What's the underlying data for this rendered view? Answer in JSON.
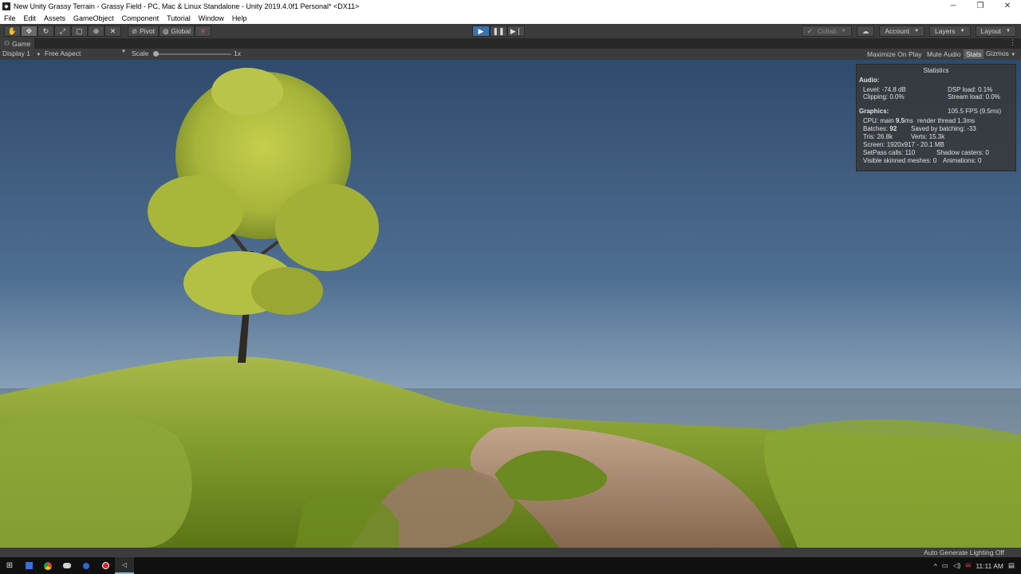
{
  "window": {
    "title": "New Unity Grassy Terrain - Grassy Field - PC, Mac & Linux Standalone - Unity 2019.4.0f1 Personal* <DX11>",
    "app_icon": "unity-icon",
    "controls": {
      "minimize": "─",
      "maximize": "❐",
      "close": "✕"
    }
  },
  "menu": [
    "File",
    "Edit",
    "Assets",
    "GameObject",
    "Component",
    "Tutorial",
    "Window",
    "Help"
  ],
  "toolbar": {
    "tools": [
      {
        "name": "hand-tool",
        "glyph": "✋"
      },
      {
        "name": "move-tool",
        "glyph": "✥"
      },
      {
        "name": "rotate-tool",
        "glyph": "↻"
      },
      {
        "name": "scale-tool",
        "glyph": "⤢"
      },
      {
        "name": "rect-tool",
        "glyph": "▢"
      },
      {
        "name": "transform-tool",
        "glyph": "⊕"
      },
      {
        "name": "custom-tool",
        "glyph": "✕"
      }
    ],
    "pivot_label": "Pivot",
    "global_label": "Global",
    "grid_icon": "#",
    "play_glyph": "▶",
    "pause_glyph": "❚❚",
    "step_glyph": "▶❘",
    "collab_label": "Collab",
    "account_label": "Account",
    "layers_label": "Layers",
    "layout_label": "Layout"
  },
  "game_tab": {
    "label": "Game",
    "display": "Display 1",
    "aspect": "Free Aspect",
    "scale_label": "Scale",
    "scale_value": "1x",
    "scale_fraction": 0.0,
    "maximize_on_play": "Maximize On Play",
    "mute_audio": "Mute Audio",
    "stats": "Stats",
    "gizmos": "Gizmos"
  },
  "stats": {
    "title": "Statistics",
    "audio_heading": "Audio:",
    "level": "Level: -74.8 dB",
    "clipping": "Clipping: 0.0%",
    "dsp_load": "DSP load: 0.1%",
    "stream_load": "Stream load: 0.0%",
    "graphics_heading": "Graphics:",
    "fps": "105.5 FPS (9.5ms)",
    "cpu_main_label": "CPU: main",
    "cpu_main_value": "9.5",
    "cpu_main_unit": "ms",
    "render_thread": "render thread 1.3ms",
    "batches_label": "Batches:",
    "batches_value": "92",
    "saved_by_batching": "Saved by batching: -33",
    "tris": "Tris: 26.8k",
    "verts": "Verts: 15.3k",
    "screen": "Screen: 1920x917 - 20.1 MB",
    "setpass": "SetPass calls: 110",
    "shadow_casters": "Shadow casters: 0",
    "skinned": "Visible skinned meshes: 0",
    "animations": "Animations: 0"
  },
  "status": {
    "lighting": "Auto Generate Lighting Off"
  },
  "taskbar": {
    "time": "11:11 AM",
    "start_glyph": "⊞",
    "tray_arrow": "^"
  }
}
